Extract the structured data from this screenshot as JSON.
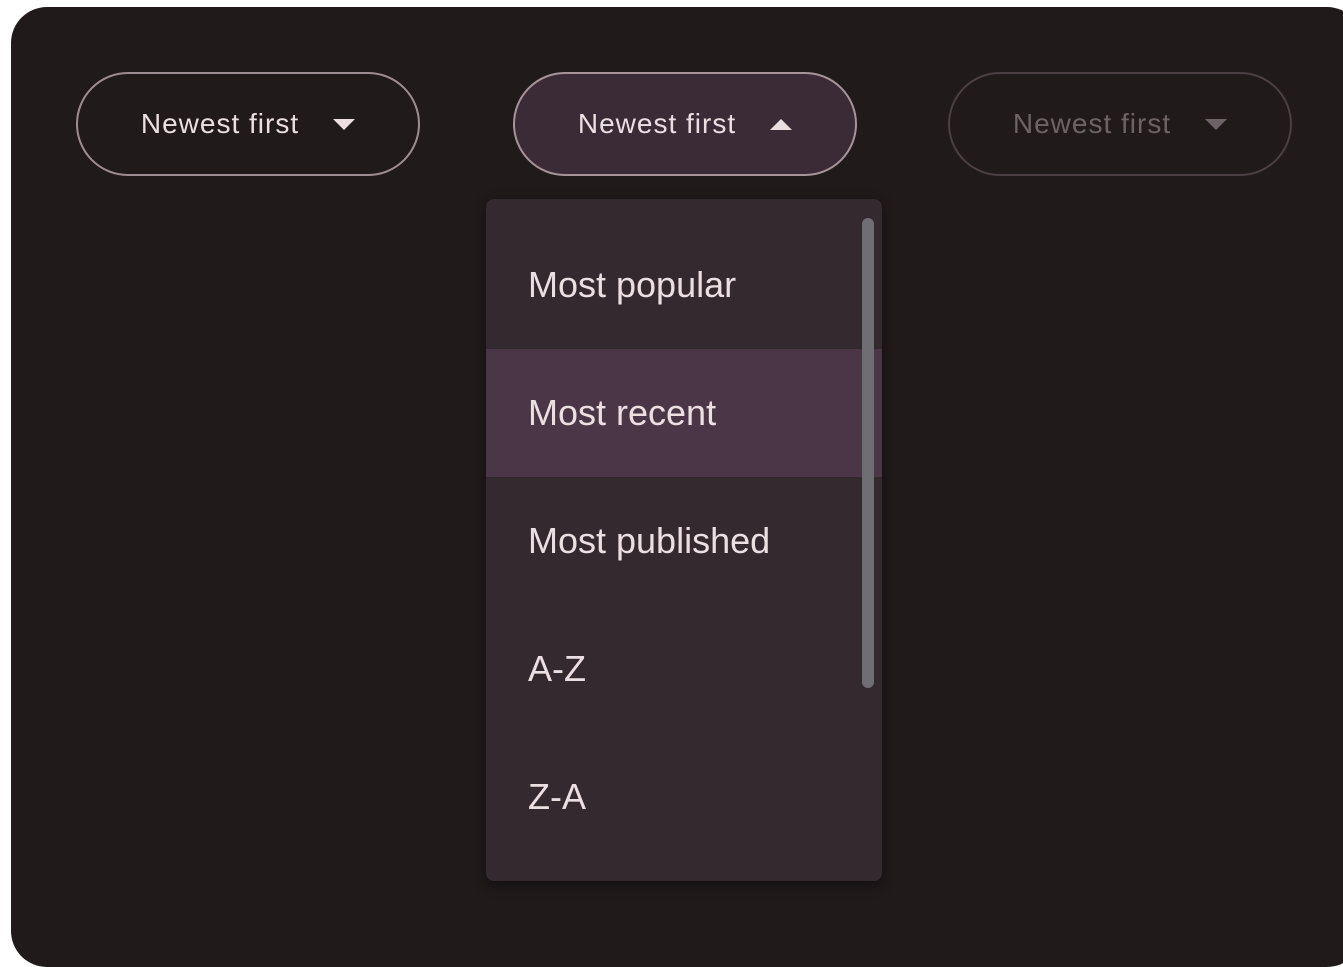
{
  "dropdowns": [
    {
      "label": "Newest first",
      "icon": "arrow-drop-down-icon",
      "state": "enabled"
    },
    {
      "label": "Newest first",
      "icon": "arrow-drop-up-icon",
      "state": "open"
    },
    {
      "label": "Newest first",
      "icon": "arrow-drop-down-icon",
      "state": "disabled"
    }
  ],
  "menu": {
    "items": [
      {
        "label": "Most popular"
      },
      {
        "label": "Most recent",
        "selected": true
      },
      {
        "label": "Most published"
      },
      {
        "label": "A-Z"
      },
      {
        "label": "Z-A"
      }
    ]
  },
  "colors": {
    "surface": "#201a1b",
    "menu_background": "#33292f",
    "selected_item": "#4b3648",
    "active_chip": "#3b2b37",
    "text": "#ecdfe2",
    "outline": "#9f8c93",
    "disabled": "#6d6366"
  }
}
